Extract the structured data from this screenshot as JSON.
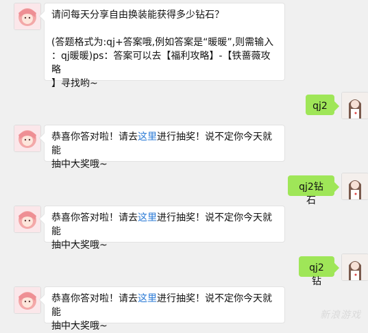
{
  "colors": {
    "background": "#f0f0f0",
    "bubble_incoming": "#ffffff",
    "bubble_outgoing": "#9fe658",
    "link": "#2a7ad6"
  },
  "messages": [
    {
      "side": "left",
      "lines": [
        "请问每天分享自由换装能获得多少钻石？",
        "",
        "(答题格式为:qj+答案哦,例如答案是“暖暖”,则需输入",
        "：qj暖暖)ps：答案可以去【福利攻略】-【铁蔷薇攻略",
        "】寻找哟~"
      ]
    },
    {
      "side": "right",
      "text": "qj2"
    },
    {
      "side": "left",
      "pre": "恭喜你答对啦！请去",
      "link": "这里",
      "post": "进行抽奖！说不定你今天就能",
      "line2": "抽中大奖哦~"
    },
    {
      "side": "right",
      "text": "qj2钻石"
    },
    {
      "side": "left",
      "pre": "恭喜你答对啦！请去",
      "link": "这里",
      "post": "进行抽奖！说不定你今天就能",
      "line2": "抽中大奖哦~"
    },
    {
      "side": "right",
      "text": "qj2钻"
    },
    {
      "side": "left",
      "pre": "恭喜你答对啦！请去",
      "link": "这里",
      "post": "进行抽奖！说不定你今天就能",
      "line2": "抽中大奖哦~"
    }
  ],
  "watermark": "新浪游戏"
}
